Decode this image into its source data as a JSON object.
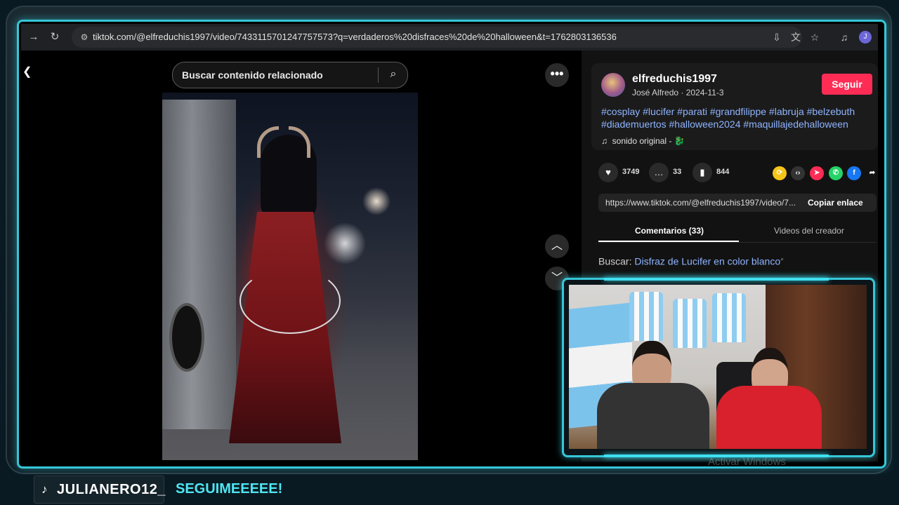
{
  "browser": {
    "url": "tiktok.com/@elfreduchis1997/video/7433115701247757573?q=verdaderos%20disfraces%20de%20halloween&t=1762803136536",
    "profile_initial": "J"
  },
  "video": {
    "search_placeholder": "Buscar contenido relacionado",
    "more_label": "•••"
  },
  "post": {
    "username": "elfreduchis1997",
    "subtitle": "José Alfredo · 2024-11-3",
    "follow_label": "Seguir",
    "hashtags": "#cosplay #lucifer #parati #grandfilippe #labruja #belzebuth #diademuertos #halloween2024 #maquillajedehalloween",
    "sound": "sonido original - 🐉",
    "likes": "3749",
    "comments": "33",
    "saves": "844",
    "link": "https://www.tiktok.com/@elfreduchis1997/video/7...",
    "copy_label": "Copiar enlace",
    "tab_comments": "Comentarios (33)",
    "tab_videos": "Videos del creador",
    "search_prefix": "Buscar:",
    "search_suggestion": "Disfraz de Lucifer en color blanco"
  },
  "stream": {
    "handle": "JULIANERO12_",
    "call_to_action": "SEGUIMEEEEE!",
    "watermark": "Activar Windows"
  },
  "colors": {
    "accent": "#36c6d8",
    "follow": "#fe2c55",
    "link": "#8fb4ff"
  }
}
